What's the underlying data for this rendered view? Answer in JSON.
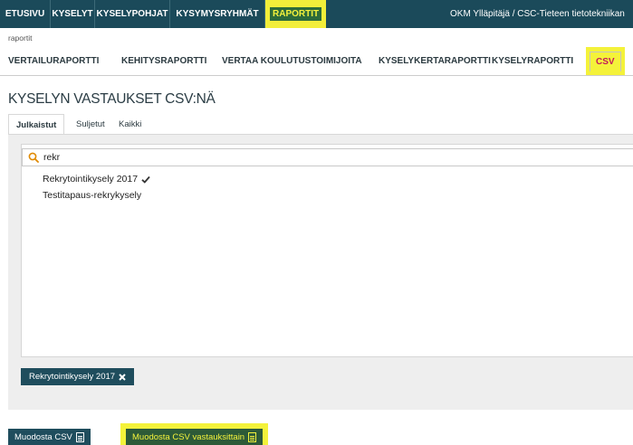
{
  "topnav": {
    "items": [
      "ETUSIVU",
      "KYSELYT",
      "KYSELYPOHJAT",
      "KYSYMYSRYHMÄT",
      "RAPORTIT"
    ],
    "active_index": 4,
    "user_label": "OKM Ylläpitäjä / CSC-Tieteen tietotekniikan"
  },
  "breadcrumb": "raportit",
  "subnav": {
    "items": [
      "VERTAILURAPORTTI",
      "KEHITYSRAPORTTI",
      "VERTAA KOULUTUSTOIMIJOITA",
      "KYSELYKERTARAPORTTI",
      "KYSELYRAPORTTI",
      "CSV"
    ],
    "active_index": 5
  },
  "page_title": "KYSELYN VASTAUKSET CSV:NÄ",
  "tabs": [
    "Julkaistut",
    "Suljetut",
    "Kaikki"
  ],
  "active_tab": 0,
  "search": {
    "value": "rekr",
    "icon": "search-icon"
  },
  "options": [
    {
      "label": "Rekrytointikysely 2017",
      "selected": true,
      "icon": "checkmark-icon"
    },
    {
      "label": "Testitapaus-rekrykysely",
      "selected": false
    }
  ],
  "selected_chip": {
    "label": "Rekrytointikysely 2017",
    "icon": "close-icon"
  },
  "buttons": {
    "generate_csv": "Muodosta CSV",
    "generate_csv_per_answer": "Muodosta CSV vastauksittain"
  },
  "colors": {
    "nav_bg": "#1b4a5a",
    "highlight": "#f4f23a",
    "button_bg": "#1f4d5d",
    "active_text": "#c2185b"
  }
}
